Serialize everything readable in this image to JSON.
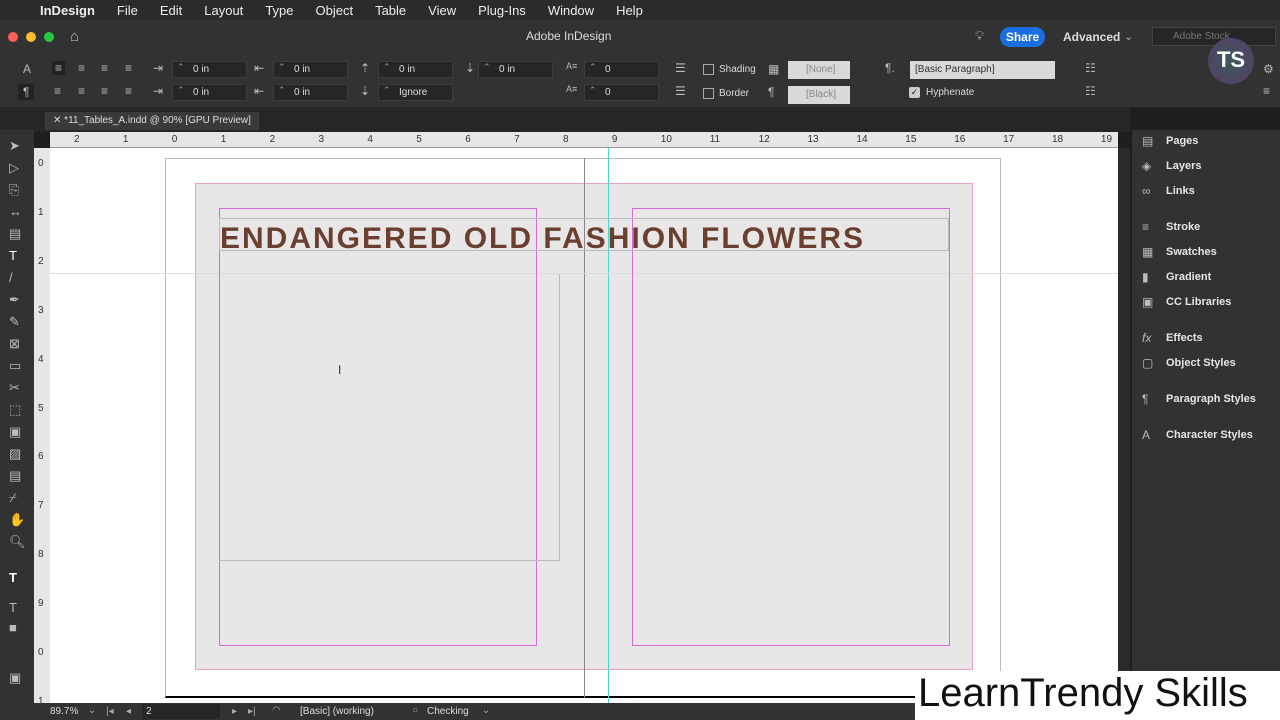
{
  "menubar": {
    "app": "InDesign",
    "items": [
      "File",
      "Edit",
      "Layout",
      "Type",
      "Object",
      "Table",
      "View",
      "Plug-Ins",
      "Window",
      "Help"
    ]
  },
  "titlebar": {
    "title": "Adobe InDesign",
    "share": "Share",
    "workspace": "Advanced",
    "search_placeholder": "Adobe Stock"
  },
  "control": {
    "left_indent": "0 in",
    "right_indent": "0 in",
    "space_before": "0 in",
    "space_after": "0 in",
    "first_indent": "0 in",
    "last_indent": "0 in",
    "align_grid": "Ignore",
    "drop_lines": "0",
    "drop_chars": "0",
    "shading": "Shading",
    "border": "Border",
    "shading_color": "[None]",
    "border_color": "[Black]",
    "paragraph_style": "[Basic Paragraph]",
    "hyphenate": "Hyphenate"
  },
  "document": {
    "tab": "*11_Tables_A.indd @ 90% [GPU Preview]",
    "heading": "ENDANGERED OLD FASHION FLOWERS"
  },
  "ruler": {
    "h": [
      "2",
      "1",
      "0",
      "1",
      "2",
      "3",
      "4",
      "5",
      "6",
      "7",
      "8",
      "9",
      "10",
      "11",
      "12",
      "13",
      "14",
      "15",
      "16",
      "17",
      "18",
      "19"
    ],
    "v": [
      "0",
      "1",
      "2",
      "3",
      "4",
      "5",
      "6",
      "7",
      "8",
      "9",
      "0",
      "1"
    ]
  },
  "panels": [
    "Pages",
    "Layers",
    "Links",
    "Stroke",
    "Swatches",
    "Gradient",
    "CC Libraries",
    "Effects",
    "Object Styles",
    "Paragraph Styles",
    "Character Styles"
  ],
  "status": {
    "zoom": "89.7%",
    "page": "2",
    "preflight_profile": "[Basic] (working)",
    "preflight_state": "Checking"
  },
  "watermark": "LearnTrendy Skills",
  "colors": {
    "heading": "#6b3f2f",
    "accent": "#1a6fe0",
    "margin": "#d36ad6"
  }
}
